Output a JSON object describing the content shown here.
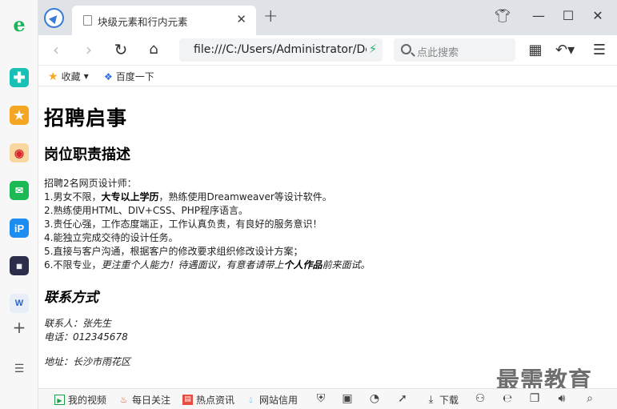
{
  "tab": {
    "title": "块级元素和行内元素"
  },
  "address": {
    "url": "file:///C:/Users/Administrator/De"
  },
  "search": {
    "placeholder": "点此搜索"
  },
  "bookmarks": {
    "favorites": "收藏",
    "baidu": "百度一下"
  },
  "page": {
    "title": "招聘启事",
    "section1": "岗位职责描述",
    "intro": "招聘2名网页设计师：",
    "line1_a": "1.男女不限，",
    "line1_b": "大专以上学历",
    "line1_c": "，熟练使用Dreamweaver等设计软件。",
    "line2": "2.熟练使用HTML、DIV+CSS、PHP程序语言。",
    "line3": "3.责任心强，工作态度端正，工作认真负责，有良好的服务意识！",
    "line4": "4.能独立完成交待的设计任务。",
    "line5": "5.直接与客户沟通，根据客户的修改要求组织修改设计方案；",
    "line6_a": "6.不限专业，",
    "line6_b": "更注重个人能力！待遇面议，有意者请带上",
    "line6_c": "个人作品",
    "line6_d": "前来面试。",
    "section2": "联系方式",
    "contact_person": "联系人：张先生",
    "phone": "电话：012345678",
    "address": "地址：长沙市雨花区"
  },
  "watermark": "最需教育",
  "statusbar": {
    "my_video": "我的视频",
    "daily": "每日关注",
    "hot": "热点资讯",
    "trust": "网站信用",
    "download": "下载"
  },
  "colors": {
    "tabbar": "#dfe3e8",
    "accent": "#3b7bd6",
    "bolt": "#21b56b",
    "star": "#f5a623"
  }
}
